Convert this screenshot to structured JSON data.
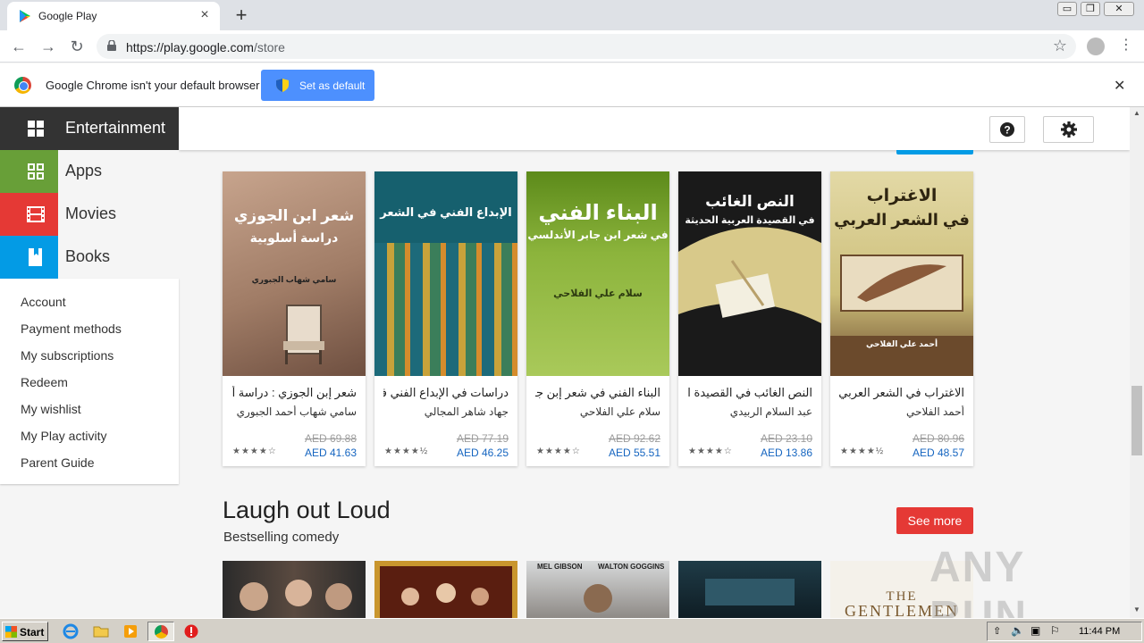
{
  "browser": {
    "tab_title": "Google Play",
    "tab_close": "×",
    "new_tab": "+",
    "url_host": "https://play.google.com",
    "url_path": "/store",
    "window_buttons": [
      "▭",
      "❐",
      "✕"
    ]
  },
  "infobar": {
    "message": "Google Chrome isn't your default browser",
    "set_default_label": "Set as default",
    "close": "✕"
  },
  "sidebar": {
    "categories": [
      {
        "label": "Entertainment",
        "icon": "grid-icon"
      },
      {
        "label": "Apps",
        "icon": "apps-icon"
      },
      {
        "label": "Movies",
        "icon": "film-icon"
      },
      {
        "label": "Books",
        "icon": "bookmark-icon"
      }
    ],
    "account_links": [
      "Account",
      "Payment methods",
      "My subscriptions",
      "Redeem",
      "My wishlist",
      "My Play activity",
      "Parent Guide"
    ]
  },
  "books": [
    {
      "title": "شعر إبن الجوزي : دراسة أسلوبية",
      "author": "سامي شهاب أحمد الجبوري",
      "old_price": "AED 69.88",
      "price": "AED 41.63",
      "rating": 4,
      "cover_title": "شعر ابن الجوزي",
      "cover_sub": "دراسة أسلوبية",
      "cover_author": "سامي شهاب الجبوري"
    },
    {
      "title": "دراسات في الإبداع الفني في الشعر",
      "author": "جهاد شاهر المجالي",
      "old_price": "AED 77.19",
      "price": "AED 46.25",
      "rating": 4.5,
      "cover_title": "الإبداع الفني في الشعر",
      "cover_sub": "",
      "cover_author": ""
    },
    {
      "title": "البناء الفني في شعر إبن جابر الأندلسي",
      "author": "سلام علي الفلاحي",
      "old_price": "AED 92.62",
      "price": "AED 55.51",
      "rating": 4,
      "cover_title": "البناء الفني",
      "cover_sub": "في شعر ابن جابر الأندلسي",
      "cover_author": "سلام علي الفلاحي"
    },
    {
      "title": "النص الغائب في القصيدة العربية الحديثة",
      "author": "عبد السلام الربيدي",
      "old_price": "AED 23.10",
      "price": "AED 13.86",
      "rating": 4,
      "cover_title": "النص الغائب",
      "cover_sub": "في القصيدة العربية الحديثة",
      "cover_author": ""
    },
    {
      "title": "الاغتراب في الشعر العربي",
      "author": "أحمد الفلاحي",
      "old_price": "AED 80.96",
      "price": "AED 48.57",
      "rating": 4.5,
      "cover_title": "الاغتراب",
      "cover_sub": "في الشعر العربي",
      "cover_author": "أحمد علي الفلاحي"
    }
  ],
  "section2": {
    "title": "Laugh out Loud",
    "subtitle": "Bestselling comedy",
    "see_more": "See more",
    "movie_credits": [
      "MEL GIBSON",
      "WALTON GOGGINS"
    ],
    "gentlemen_the": "THE",
    "gentlemen_title": "GENTLEMEN"
  },
  "watermark": "ANY RUN",
  "taskbar": {
    "start": "Start",
    "clock": "11:44 PM"
  },
  "colors": {
    "apps": "#689f38",
    "movies": "#e53935",
    "books": "#039be5",
    "entertainment": "#333333",
    "set_default": "#4d90fe"
  }
}
